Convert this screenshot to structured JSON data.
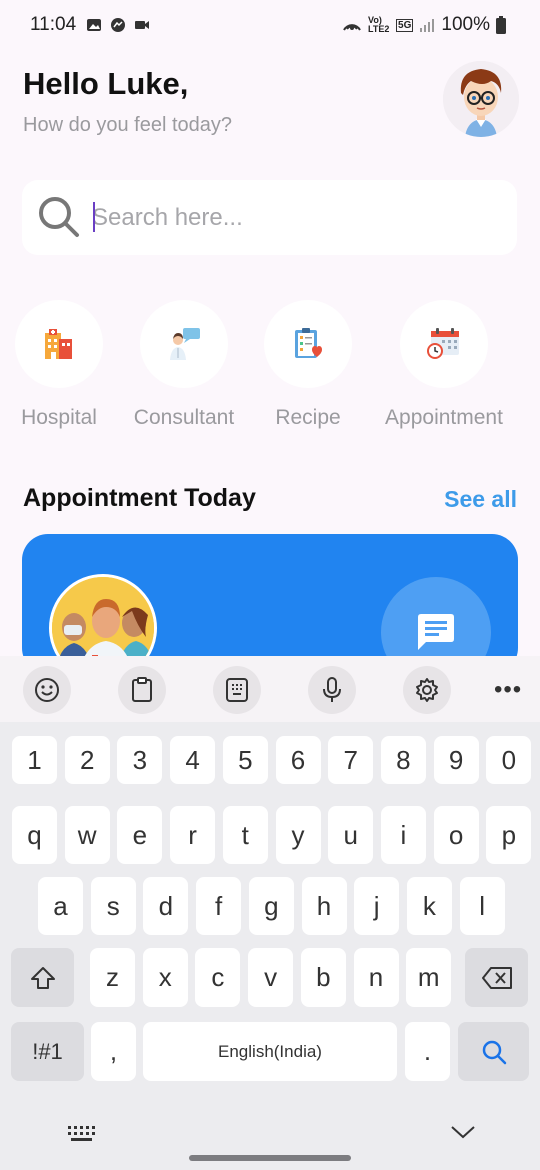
{
  "status_bar": {
    "time": "11:04",
    "battery": "100%",
    "network": "5G",
    "volte": "Vo) LTE2"
  },
  "header": {
    "greeting": "Hello Luke,",
    "subtitle": "How do you feel today?"
  },
  "search": {
    "placeholder": "Search here..."
  },
  "categories": [
    {
      "label": "Hospital",
      "icon": "hospital-icon"
    },
    {
      "label": "Consultant",
      "icon": "consultant-icon"
    },
    {
      "label": "Recipe",
      "icon": "recipe-icon"
    },
    {
      "label": "Appointment",
      "icon": "appointment-icon"
    }
  ],
  "appointments": {
    "title": "Appointment Today",
    "see_all": "See all"
  },
  "keyboard": {
    "toolbar": [
      "emoji-icon",
      "clipboard-icon",
      "keypad-icon",
      "mic-icon",
      "settings-icon",
      "more-icon"
    ],
    "row_numbers": [
      "1",
      "2",
      "3",
      "4",
      "5",
      "6",
      "7",
      "8",
      "9",
      "0"
    ],
    "row_1": [
      "q",
      "w",
      "e",
      "r",
      "t",
      "y",
      "u",
      "i",
      "o",
      "p"
    ],
    "row_2": [
      "a",
      "s",
      "d",
      "f",
      "g",
      "h",
      "j",
      "k",
      "l"
    ],
    "row_3": [
      "z",
      "x",
      "c",
      "v",
      "b",
      "n",
      "m"
    ],
    "symbols": "!#1",
    "comma": ",",
    "space": "English(India)",
    "period": "."
  },
  "colors": {
    "accent": "#3d9be9",
    "card": "#2184f0",
    "background": "#fcf7fc"
  }
}
